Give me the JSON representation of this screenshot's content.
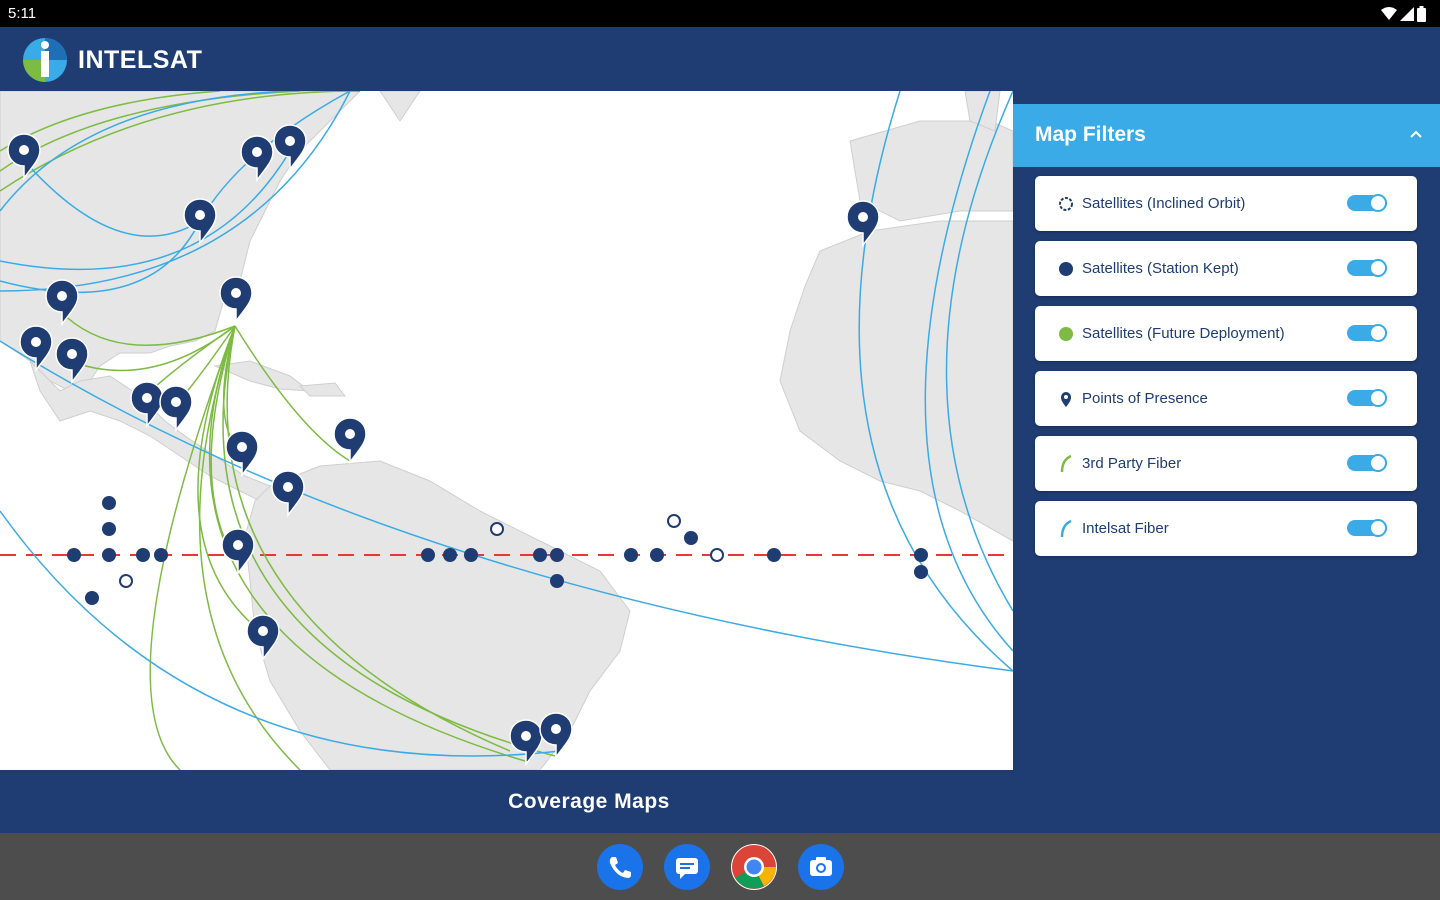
{
  "status_bar": {
    "time": "5:11"
  },
  "header": {
    "brand_name": "INTELSAT",
    "logo_icon": "intelsat-globe-logo"
  },
  "map": {
    "pins": [
      {
        "name": "pin-1"
      },
      {
        "name": "pin-2"
      }
    ]
  },
  "caption": "Coverage Maps",
  "filters": {
    "title": "Map Filters",
    "collapse_icon": "chevron-up-icon",
    "items": [
      {
        "label": "Satellites (Inclined Orbit)",
        "icon": "hollow-circle-icon",
        "enabled": true
      },
      {
        "label": "Satellites (Station Kept)",
        "icon": "filled-circle-icon",
        "enabled": true
      },
      {
        "label": "Satellites (Future Deployment)",
        "icon": "green-circle-icon",
        "enabled": true
      },
      {
        "label": "Points of Presence",
        "icon": "map-pin-icon",
        "enabled": true
      },
      {
        "label": "3rd Party Fiber",
        "icon": "green-arc-icon",
        "enabled": true
      },
      {
        "label": "Intelsat Fiber",
        "icon": "blue-arc-icon",
        "enabled": true
      }
    ]
  },
  "colors": {
    "navy": "#1f3d72",
    "accent_blue": "#3aabe6",
    "fiber_green": "#7dbb42",
    "equator_red": "#e53935"
  },
  "dock": [
    {
      "app": "phone-app-icon"
    },
    {
      "app": "messages-app-icon"
    },
    {
      "app": "chrome-app-icon"
    },
    {
      "app": "camera-app-icon"
    }
  ]
}
